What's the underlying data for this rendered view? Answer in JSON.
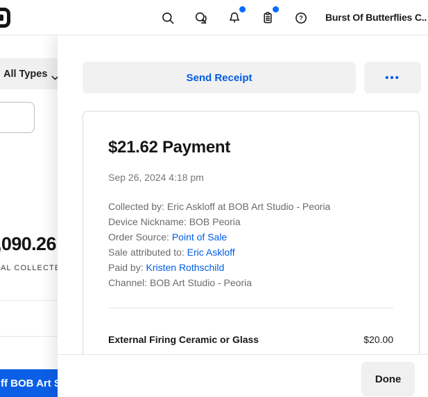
{
  "topbar": {
    "business_name": "Burst Of Butterflies C..",
    "icons": [
      "search",
      "messages",
      "notifications",
      "setup-guide",
      "help"
    ],
    "notifications_badge": true,
    "setup_guide_badge": true
  },
  "background": {
    "filter_label": "All Types",
    "total_amount_fragment": ",090.26",
    "total_caption_fragment": "AL COLLECTE",
    "banner_fragment": "ff BOB Art St"
  },
  "panel": {
    "send_receipt_label": "Send Receipt",
    "more_label": "•••",
    "done_label": "Done"
  },
  "payment": {
    "title": "$21.62 Payment",
    "timestamp": "Sep 26, 2024 4:18 pm",
    "details": [
      {
        "label": "Collected by: ",
        "value": "Eric Askloff at BOB Art Studio - Peoria",
        "link": false
      },
      {
        "label": "Device Nickname: ",
        "value": "BOB Peoria",
        "link": false
      },
      {
        "label": "Order Source: ",
        "value": "Point of Sale",
        "link": true
      },
      {
        "label": "Sale attributed to: ",
        "value": "Eric Askloff",
        "link": true
      },
      {
        "label": "Paid by: ",
        "value": "Kristen Rothschild",
        "link": true
      },
      {
        "label": "Channel: ",
        "value": "BOB Art Studio - Peoria",
        "link": false
      }
    ],
    "line_item": {
      "name": "External Firing Ceramic or Glass",
      "price": "$20.00"
    }
  },
  "colors": {
    "accent_link": "#005ce6",
    "badge_blue": "#0a6bff",
    "banner_blue": "#0b5fe6",
    "button_gray": "#f1f1f1",
    "border_gray": "#dcdcdc"
  }
}
